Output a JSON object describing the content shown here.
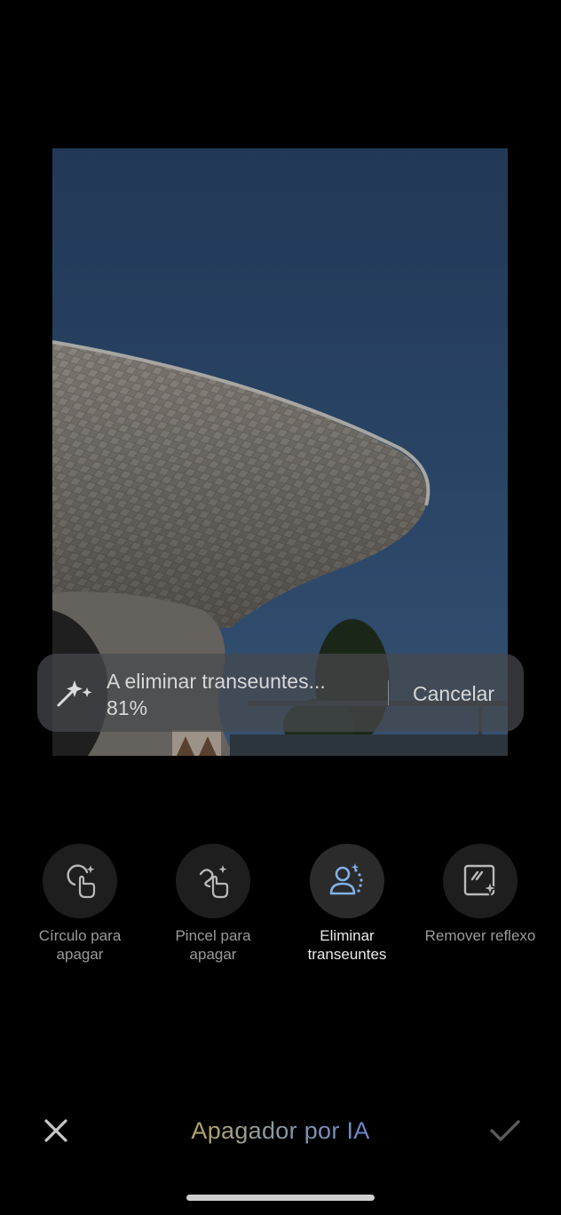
{
  "progress": {
    "status_text": "A eliminar transeuntes...",
    "percent_text": "81%",
    "cancel_label": "Cancelar",
    "icon": "magic-wand-icon"
  },
  "tools": [
    {
      "label_line1": "Círculo para",
      "label_line2": "apagar",
      "icon": "circle-erase-icon",
      "active": false
    },
    {
      "label_line1": "Pincel para",
      "label_line2": "apagar",
      "icon": "brush-erase-icon",
      "active": false
    },
    {
      "label_line1": "Eliminar",
      "label_line2": "transeuntes",
      "icon": "remove-people-icon",
      "active": true
    },
    {
      "label_line1": "Remover reflexo",
      "label_line2": "",
      "icon": "remove-reflection-icon",
      "active": false
    }
  ],
  "bottom_bar": {
    "title": "Apagador por IA",
    "close_icon": "close-icon",
    "confirm_icon": "check-icon"
  },
  "colors": {
    "accent_blue": "#7fb1e8",
    "background": "#000000"
  }
}
